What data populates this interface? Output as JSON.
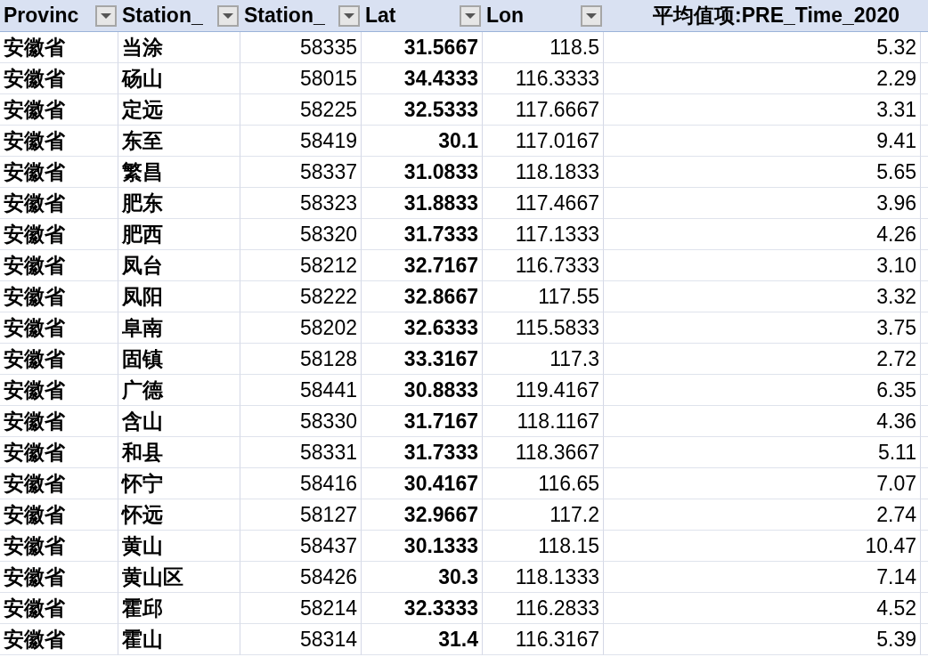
{
  "pivot_table": {
    "columns": [
      {
        "label": "Provinc",
        "filter": true
      },
      {
        "label": "Station_",
        "filter": true
      },
      {
        "label": "Station_",
        "filter": true
      },
      {
        "label": "Lat",
        "filter": true
      },
      {
        "label": "Lon",
        "filter": true
      },
      {
        "label": "平均值项:PRE_Time_2020",
        "filter": false
      }
    ],
    "rows": [
      [
        "安徽省",
        "当涂",
        "58335",
        "31.5667",
        "118.5",
        "5.32"
      ],
      [
        "安徽省",
        "砀山",
        "58015",
        "34.4333",
        "116.3333",
        "2.29"
      ],
      [
        "安徽省",
        "定远",
        "58225",
        "32.5333",
        "117.6667",
        "3.31"
      ],
      [
        "安徽省",
        "东至",
        "58419",
        "30.1",
        "117.0167",
        "9.41"
      ],
      [
        "安徽省",
        "繁昌",
        "58337",
        "31.0833",
        "118.1833",
        "5.65"
      ],
      [
        "安徽省",
        "肥东",
        "58323",
        "31.8833",
        "117.4667",
        "3.96"
      ],
      [
        "安徽省",
        "肥西",
        "58320",
        "31.7333",
        "117.1333",
        "4.26"
      ],
      [
        "安徽省",
        "凤台",
        "58212",
        "32.7167",
        "116.7333",
        "3.10"
      ],
      [
        "安徽省",
        "凤阳",
        "58222",
        "32.8667",
        "117.55",
        "3.32"
      ],
      [
        "安徽省",
        "阜南",
        "58202",
        "32.6333",
        "115.5833",
        "3.75"
      ],
      [
        "安徽省",
        "固镇",
        "58128",
        "33.3167",
        "117.3",
        "2.72"
      ],
      [
        "安徽省",
        "广德",
        "58441",
        "30.8833",
        "119.4167",
        "6.35"
      ],
      [
        "安徽省",
        "含山",
        "58330",
        "31.7167",
        "118.1167",
        "4.36"
      ],
      [
        "安徽省",
        "和县",
        "58331",
        "31.7333",
        "118.3667",
        "5.11"
      ],
      [
        "安徽省",
        "怀宁",
        "58416",
        "30.4167",
        "116.65",
        "7.07"
      ],
      [
        "安徽省",
        "怀远",
        "58127",
        "32.9667",
        "117.2",
        "2.74"
      ],
      [
        "安徽省",
        "黄山",
        "58437",
        "30.1333",
        "118.15",
        "10.47"
      ],
      [
        "安徽省",
        "黄山区",
        "58426",
        "30.3",
        "118.1333",
        "7.14"
      ],
      [
        "安徽省",
        "霍邱",
        "58214",
        "32.3333",
        "116.2833",
        "4.52"
      ],
      [
        "安徽省",
        "霍山",
        "58314",
        "31.4",
        "116.3167",
        "5.39"
      ]
    ]
  }
}
